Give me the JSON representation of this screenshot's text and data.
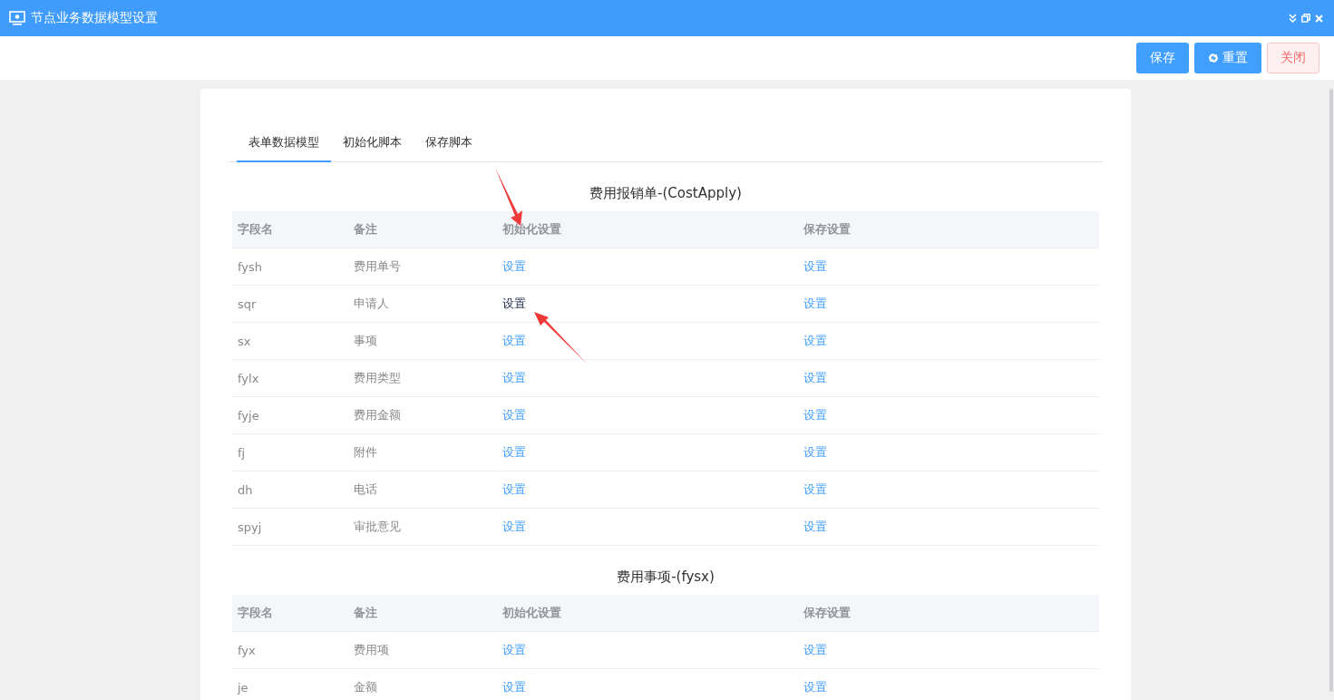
{
  "window": {
    "title": "节点业务数据模型设置"
  },
  "toolbar": {
    "buttons": [
      {
        "label": "保存",
        "kind": "primary"
      },
      {
        "label": "重置",
        "kind": "reset"
      },
      {
        "label": "关闭",
        "kind": "danger"
      }
    ]
  },
  "tabs": [
    {
      "label": "表单数据模型",
      "selected": true
    },
    {
      "label": "初始化脚本",
      "selected": false
    },
    {
      "label": "保存脚本",
      "selected": false
    }
  ],
  "sections": [
    {
      "title": "费用报销单-(CostApply)",
      "columns": [
        "字段名",
        "备注",
        "初始化设置",
        "保存设置"
      ],
      "rows": [
        {
          "field": "fysh",
          "note": "费用单号",
          "init": {
            "label": "设置",
            "hovered": false
          },
          "save": {
            "label": "设置",
            "hovered": false
          }
        },
        {
          "field": "sqr",
          "note": "申请人",
          "init": {
            "label": "设置",
            "hovered": true
          },
          "save": {
            "label": "设置",
            "hovered": false
          }
        },
        {
          "field": "sx",
          "note": "事项",
          "init": {
            "label": "设置",
            "hovered": false
          },
          "save": {
            "label": "设置",
            "hovered": false
          }
        },
        {
          "field": "fylx",
          "note": "费用类型",
          "init": {
            "label": "设置",
            "hovered": false
          },
          "save": {
            "label": "设置",
            "hovered": false
          }
        },
        {
          "field": "fyje",
          "note": "费用金额",
          "init": {
            "label": "设置",
            "hovered": false
          },
          "save": {
            "label": "设置",
            "hovered": false
          }
        },
        {
          "field": "fj",
          "note": "附件",
          "init": {
            "label": "设置",
            "hovered": false
          },
          "save": {
            "label": "设置",
            "hovered": false
          }
        },
        {
          "field": "dh",
          "note": "电话",
          "init": {
            "label": "设置",
            "hovered": false
          },
          "save": {
            "label": "设置",
            "hovered": false
          }
        },
        {
          "field": "spyj",
          "note": "审批意见",
          "init": {
            "label": "设置",
            "hovered": false
          },
          "save": {
            "label": "设置",
            "hovered": false
          }
        }
      ]
    },
    {
      "title": "费用事项-(fysx)",
      "columns": [
        "字段名",
        "备注",
        "初始化设置",
        "保存设置"
      ],
      "rows": [
        {
          "field": "fyx",
          "note": "费用项",
          "init": {
            "label": "设置",
            "hovered": false
          },
          "save": {
            "label": "设置",
            "hovered": false
          }
        },
        {
          "field": "je",
          "note": "金额",
          "init": {
            "label": "设置",
            "hovered": false
          },
          "save": {
            "label": "设置",
            "hovered": false
          }
        }
      ]
    }
  ]
}
